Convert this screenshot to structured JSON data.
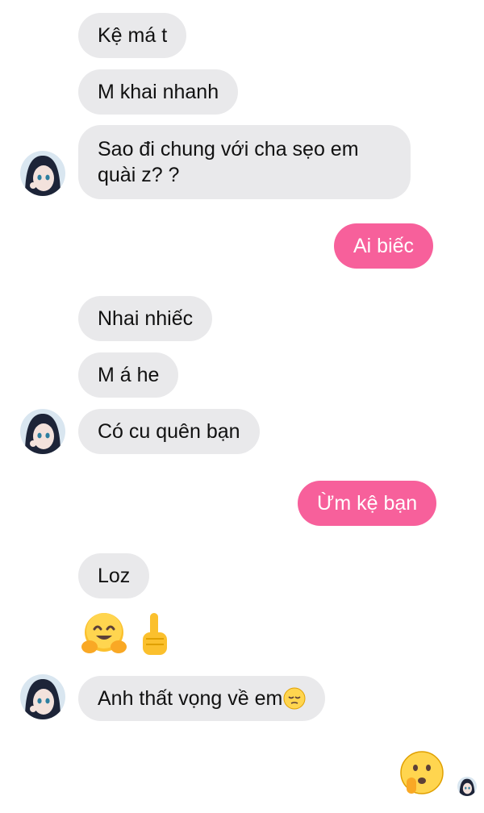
{
  "chat": {
    "messages": [
      {
        "sender": "them",
        "text": "Kệ má t"
      },
      {
        "sender": "them",
        "text": "M khai nhanh"
      },
      {
        "sender": "them",
        "text": "Sao đi chung với cha sẹo em quài z? ?"
      },
      {
        "sender": "me",
        "text": "Ai biếc"
      },
      {
        "sender": "them",
        "text": "Nhai nhiếc"
      },
      {
        "sender": "them",
        "text": "M á he"
      },
      {
        "sender": "them",
        "text": "Có cu quên bạn"
      },
      {
        "sender": "me",
        "text": "Ừm kệ bạn"
      },
      {
        "sender": "them",
        "text": "Loz"
      },
      {
        "sender": "them",
        "emojis": [
          "hugging-face-emoji",
          "pointing-up-hand-emoji"
        ]
      },
      {
        "sender": "them",
        "text": "Anh thất vọng về em",
        "trailing_emoji": "pensive-face-emoji"
      },
      {
        "sender": "me",
        "emojis": [
          "shushing-face-emoji"
        ]
      }
    ],
    "avatar_icon": "anime-girl-avatar-icon",
    "seen_indicator_icon": "seen-avatar-icon"
  },
  "colors": {
    "incoming_bubble": "#e9e9eb",
    "outgoing_bubble": "#f7609b",
    "outgoing_text": "#ffffff",
    "incoming_text": "#111111"
  }
}
